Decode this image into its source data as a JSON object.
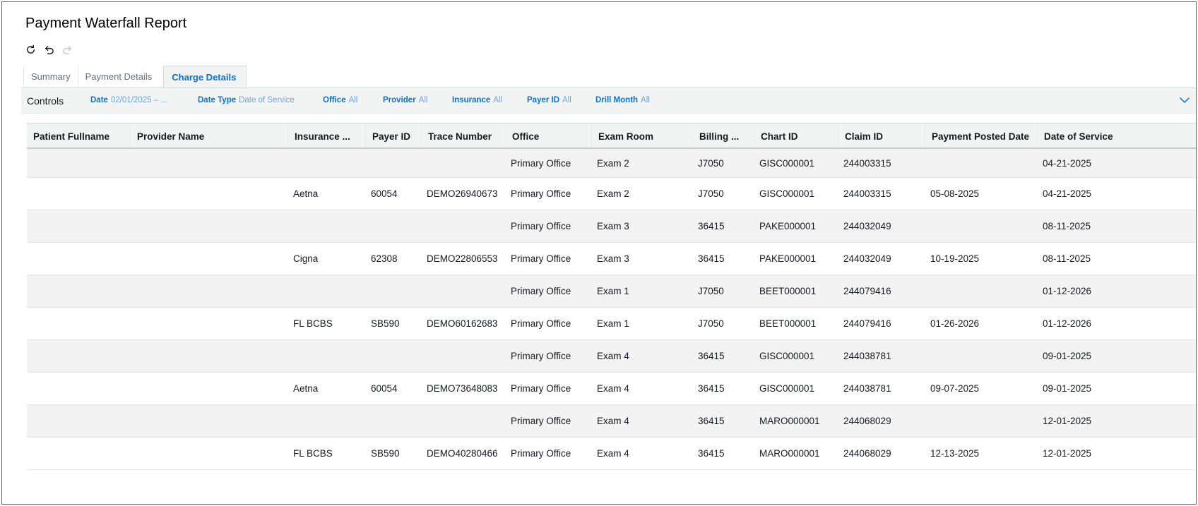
{
  "title": "Payment Waterfall Report",
  "toolbar": {
    "icons": [
      "refresh-icon",
      "undo-icon",
      "redo-icon"
    ]
  },
  "tabs": [
    {
      "label": "Summary",
      "active": false
    },
    {
      "label": "Payment Details",
      "active": false
    },
    {
      "label": "Charge Details",
      "active": true
    }
  ],
  "controls": {
    "label": "Controls",
    "filters": [
      {
        "key": "Date",
        "value": "02/01/2025 – ..."
      },
      {
        "key": "Date Type",
        "value": "Date of Service"
      },
      {
        "key": "Office",
        "value": "All"
      },
      {
        "key": "Provider",
        "value": "All"
      },
      {
        "key": "Insurance",
        "value": "All"
      },
      {
        "key": "Payer ID",
        "value": "All"
      },
      {
        "key": "Drill Month",
        "value": "All"
      }
    ]
  },
  "table": {
    "columns": [
      "Patient Fullname",
      "Provider Name",
      "Insurance ...",
      "Payer ID",
      "Trace Number",
      "Office",
      "Exam Room",
      "Billing ...",
      "Chart ID",
      "Claim ID",
      "Payment Posted Date",
      "Date of Service"
    ],
    "rows": [
      [
        "",
        "",
        "",
        "",
        "",
        "Primary Office",
        "Exam 2",
        "J7050",
        "GISC000001",
        "244003315",
        "",
        "04-21-2025"
      ],
      [
        "",
        "",
        "Aetna",
        "60054",
        "DEMO26940673",
        "Primary Office",
        "Exam 2",
        "J7050",
        "GISC000001",
        "244003315",
        "05-08-2025",
        "04-21-2025"
      ],
      [
        "",
        "",
        "",
        "",
        "",
        "Primary Office",
        "Exam 3",
        "36415",
        "PAKE000001",
        "244032049",
        "",
        "08-11-2025"
      ],
      [
        "",
        "",
        "Cigna",
        "62308",
        "DEMO22806553",
        "Primary Office",
        "Exam 3",
        "36415",
        "PAKE000001",
        "244032049",
        "10-19-2025",
        "08-11-2025"
      ],
      [
        "",
        "",
        "",
        "",
        "",
        "Primary Office",
        "Exam 1",
        "J7050",
        "BEET000001",
        "244079416",
        "",
        "01-12-2026"
      ],
      [
        "",
        "",
        "FL BCBS",
        "SB590",
        "DEMO60162683",
        "Primary Office",
        "Exam 1",
        "J7050",
        "BEET000001",
        "244079416",
        "01-26-2026",
        "01-12-2026"
      ],
      [
        "",
        "",
        "",
        "",
        "",
        "Primary Office",
        "Exam 4",
        "36415",
        "GISC000001",
        "244038781",
        "",
        "09-01-2025"
      ],
      [
        "",
        "",
        "Aetna",
        "60054",
        "DEMO73648083",
        "Primary Office",
        "Exam 4",
        "36415",
        "GISC000001",
        "244038781",
        "09-07-2025",
        "09-01-2025"
      ],
      [
        "",
        "",
        "",
        "",
        "",
        "Primary Office",
        "Exam 4",
        "36415",
        "MARO000001",
        "244068029",
        "",
        "12-01-2025"
      ],
      [
        "",
        "",
        "FL BCBS",
        "SB590",
        "DEMO40280466",
        "Primary Office",
        "Exam 4",
        "36415",
        "MARO000001",
        "244068029",
        "12-13-2025",
        "12-01-2025"
      ]
    ]
  }
}
